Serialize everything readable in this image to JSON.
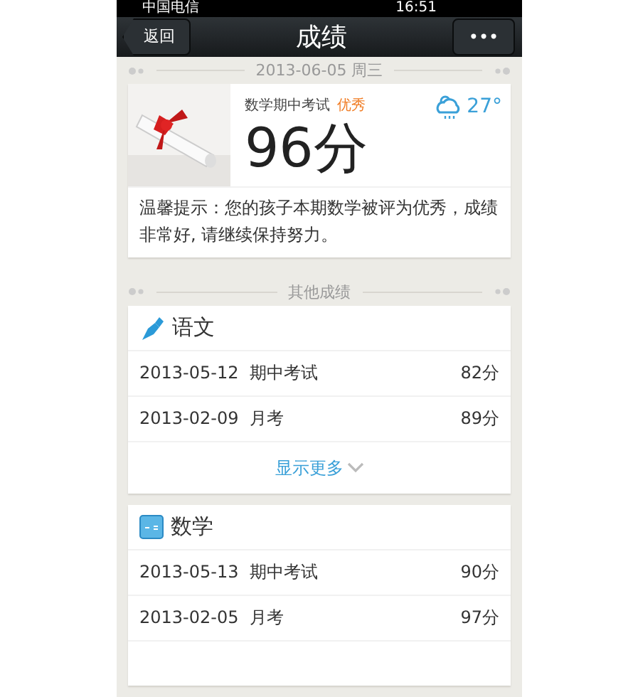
{
  "status_bar": {
    "carrier": "中国电信",
    "time": "16:51"
  },
  "nav": {
    "back": "返回",
    "title": "成绩",
    "more": "•••"
  },
  "date_divider": "2013-06-05 周三",
  "highlight": {
    "exam": "数学期中考试",
    "rating": "优秀",
    "score": "96分",
    "temperature": "27°",
    "tip": "温馨提示：您的孩子本期数学被评为优秀，成绩非常好, 请继续保持努力。"
  },
  "other_divider": "其他成绩",
  "subjects": [
    {
      "kind": "pen",
      "name": "语文",
      "rows": [
        {
          "date": "2013-05-12",
          "exam": "期中考试",
          "score": "82分"
        },
        {
          "date": "2013-02-09",
          "exam": "月考",
          "score": "89分"
        }
      ],
      "more": "显示更多"
    },
    {
      "kind": "board",
      "name": "数学",
      "rows": [
        {
          "date": "2013-05-13",
          "exam": "期中考试",
          "score": "90分"
        },
        {
          "date": "2013-02-05",
          "exam": "月考",
          "score": "97分"
        }
      ]
    }
  ]
}
